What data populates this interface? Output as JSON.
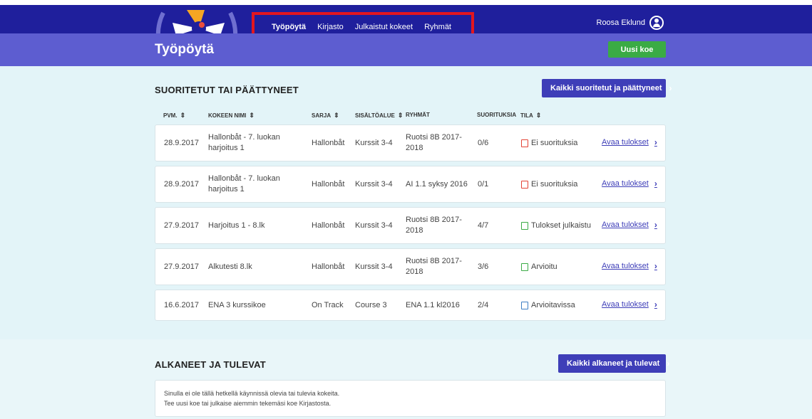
{
  "nav": {
    "items": [
      {
        "label": "Työpöytä",
        "active": true
      },
      {
        "label": "Kirjasto",
        "active": false
      },
      {
        "label": "Julkaistut kokeet",
        "active": false
      },
      {
        "label": "Ryhmät",
        "active": false
      }
    ],
    "user_name": "Roosa Eklund"
  },
  "header": {
    "title": "Työpöytä",
    "new_exam_label": "Uusi koe"
  },
  "completed": {
    "title": "SUORITETUT TAI PÄÄTTYNEET",
    "all_button_label": "Kaikki suoritetut ja päättyneet",
    "columns": {
      "date": "PVM.",
      "name": "KOKEEN NIMI",
      "series": "SARJA",
      "content": "SISÄLTÖALUE",
      "groups": "RYHMÄT",
      "submissions": "SUORITUKSIA",
      "state": "TILA"
    },
    "rows": [
      {
        "date": "28.9.2017",
        "name": "Hallonbåt - 7. luokan harjoitus 1",
        "series": "Hallonbåt",
        "content": "Kurssit 3-4",
        "groups": "Ruotsi 8B 2017-2018",
        "submissions": "0/6",
        "status": "Ei suorituksia",
        "status_type": "none",
        "link": "Avaa tulokset"
      },
      {
        "date": "28.9.2017",
        "name": "Hallonbåt - 7. luokan harjoitus 1",
        "series": "Hallonbåt",
        "content": "Kurssit 3-4",
        "groups": "AI 1.1 syksy 2016",
        "submissions": "0/1",
        "status": "Ei suorituksia",
        "status_type": "none",
        "link": "Avaa tulokset"
      },
      {
        "date": "27.9.2017",
        "name": "Harjoitus 1 - 8.lk",
        "series": "Hallonbåt",
        "content": "Kurssit 3-4",
        "groups": "Ruotsi 8B 2017-2018",
        "submissions": "4/7",
        "status": "Tulokset julkaistu",
        "status_type": "published",
        "link": "Avaa tulokset"
      },
      {
        "date": "27.9.2017",
        "name": "Alkutesti 8.lk",
        "series": "Hallonbåt",
        "content": "Kurssit 3-4",
        "groups": "Ruotsi 8B 2017-2018",
        "submissions": "3/6",
        "status": "Arvioitu",
        "status_type": "graded",
        "link": "Avaa tulokset"
      },
      {
        "date": "16.6.2017",
        "name": "ENA 3 kurssikoe",
        "series": "On Track",
        "content": "Course 3",
        "groups": "ENA 1.1 kl2016",
        "submissions": "2/4",
        "status": "Arvioitavissa",
        "status_type": "gradable",
        "link": "Avaa tulokset"
      }
    ]
  },
  "upcoming": {
    "title": "ALKANEET JA TULEVAT",
    "all_button_label": "Kaikki alkaneet ja tulevat",
    "empty_line1": "Sinulla ei ole tällä hetkellä käynnissä olevia tai tulevia kokeita.",
    "empty_line2": "Tee uusi koe tai julkaise aiemmin tekemäsi koe Kirjastosta."
  },
  "colors": {
    "nav_bg": "#1f1f9c",
    "subbar_bg": "#5d5dd0",
    "accent": "#3e3eb8",
    "green": "#3aab45",
    "status_none": "#e34234",
    "status_ok": "#3aab45",
    "status_gradable": "#3e7fc4",
    "highlight": "#e3161f"
  },
  "icons": [
    "logo-flower-icon",
    "user-avatar-icon",
    "sort-icon",
    "chevron-right-icon",
    "status-icon"
  ]
}
